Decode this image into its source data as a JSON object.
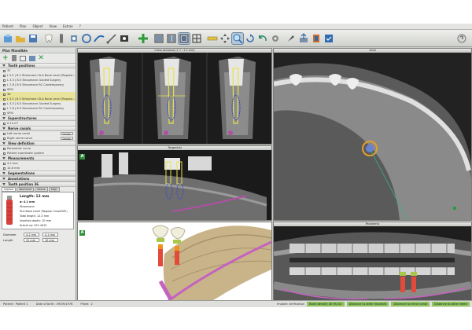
{
  "menu": {
    "items": [
      "Patient",
      "Plan",
      "Object",
      "View",
      "Extras",
      "?"
    ]
  },
  "panel": {
    "plan_label": "Plan",
    "plan_name": "Mandible",
    "sections": {
      "tooth_positions": "Tooth positions",
      "superstructures": "Superstructures",
      "nerve_canals": "Nerve canals",
      "view_definition": "View definition",
      "measurements": "Measurements",
      "segmentations": "Segmentations",
      "annotations": "Annotations",
      "tooth_position": "Tooth position 36",
      "density": "Density values"
    },
    "tooth_rows": [
      {
        "label": "37",
        "hl": false
      },
      {
        "label": "L 3.3 | 8.5  Straumann SLA Bone Level (Regular...",
        "hl": false
      },
      {
        "label": "L 3.3 | 8.5  Straumann Guided Surgery",
        "hl": false
      },
      {
        "label": "L 7.8 | 8.5  Straumann RC Contemporary",
        "hl": false
      },
      {
        "label": "SPIII",
        "hl": false
      },
      {
        "label": "36",
        "hl": true
      },
      {
        "label": "L 3.3 | 8.5  Straumann SLA Bone Level (Regular...",
        "hl": true
      },
      {
        "label": "L 3.3 | 8.5  Straumann Guided Surgery",
        "hl": false
      },
      {
        "label": "L 7.8 | 8.5  Straumann RC Contemporary",
        "hl": false
      },
      {
        "label": "SPIII",
        "hl": false
      }
    ],
    "superstructure_value": "0.14 m³",
    "nerve_rows": [
      {
        "label": "Left nerve canal",
        "btn": "Delete"
      },
      {
        "label": "Right nerve canal",
        "btn": "Delete"
      }
    ],
    "view_rows": [
      "Panoramic curve",
      "Patient coordinate system"
    ],
    "measurement_rows": [
      "4.2 mm",
      "14.6 mm"
    ],
    "tabs": [
      "Implant",
      "Abutment",
      "Sleeve",
      "Align"
    ],
    "implant_info": [
      "Length: 12 mm",
      "ø: 4.1 mm",
      "Straumann",
      "SLA Bone Level (Regular CrossFit®)",
      "Total length: 12.3 mm",
      "Insertion depth: 10 mm",
      "Article no: 021.4412"
    ],
    "diameter_label": "Diameter",
    "diameter_value": "4.1 mm",
    "length_label": "Length",
    "length_value": "12 mm",
    "length_value2": "10 mm"
  },
  "viewports": {
    "cross": {
      "title": "Cross-sectional (1.7 / 1.2 mm)"
    },
    "axial": {
      "title": "Axial"
    },
    "tangential": {
      "title": "Tangential"
    },
    "view3d": {
      "title": "3D"
    },
    "panoramic": {
      "title": "Panoramic"
    },
    "badge": "A"
  },
  "status": {
    "patient_label": "Patient:",
    "patient_value": "Patient 1",
    "dob_label": "Date of birth:",
    "dob_value": "09/09/1976",
    "plane_label": "Plane:",
    "plane_value": "2",
    "implant_note": "Implant verification",
    "msg1": "Bone density 40 HU/10",
    "msg2": "Distance to other implants",
    "msg3": "Distance to nerve canal",
    "msg4": "Distance to other teeth"
  },
  "colors": {
    "accent_green": "#8fc45a",
    "highlight": "#e8e39a",
    "viewport_bg": "#141414"
  }
}
